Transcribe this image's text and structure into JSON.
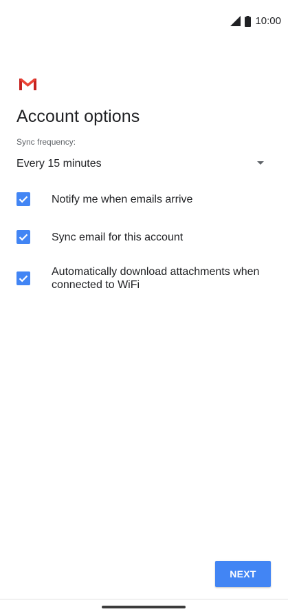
{
  "status_bar": {
    "time": "10:00",
    "signal_icon": "signal-icon",
    "battery_icon": "battery-icon"
  },
  "app": {
    "logo": "gmail-logo"
  },
  "page": {
    "title": "Account options"
  },
  "sync": {
    "label": "Sync frequency:",
    "value": "Every 15 minutes"
  },
  "options": [
    {
      "label": "Notify me when emails arrive",
      "checked": true
    },
    {
      "label": "Sync email for this account",
      "checked": true
    },
    {
      "label": "Automatically download attachments when connected to WiFi",
      "checked": true
    }
  ],
  "footer": {
    "next_label": "NEXT"
  },
  "colors": {
    "accent": "#4285f4",
    "text": "#202124",
    "secondary": "#5f6368"
  }
}
